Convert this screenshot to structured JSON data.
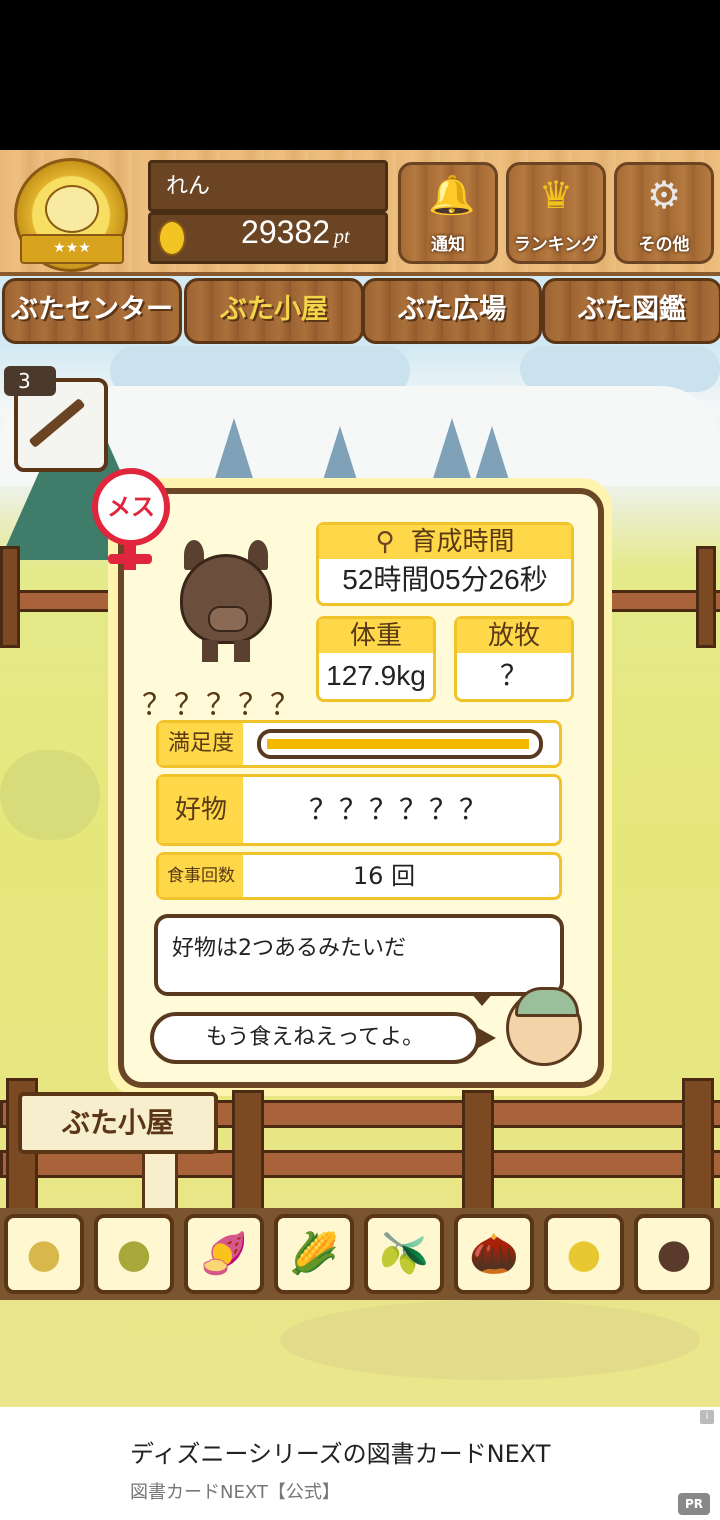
{
  "header": {
    "player_name": "れん",
    "points_value": "29382",
    "points_unit": "pt",
    "buttons": [
      {
        "label": "通知",
        "icon": "bell-icon"
      },
      {
        "label": "ランキング",
        "icon": "crown-icon"
      },
      {
        "label": "その他",
        "icon": "gear-icon"
      }
    ]
  },
  "tabs": [
    {
      "label": "ぶたセンター",
      "active": false
    },
    {
      "label": "ぶた小屋",
      "active": true
    },
    {
      "label": "ぶた広場",
      "active": false
    },
    {
      "label": "ぶた図鑑",
      "active": false
    }
  ],
  "item": {
    "count": "3",
    "icon": "syringe-icon"
  },
  "pig": {
    "gender_label": "メス",
    "name": "？？？？？",
    "growth_time_label": "育成時間",
    "growth_time_value": "52時間05分26秒",
    "weight_label": "体重",
    "weight_value": "127.9kg",
    "grazing_label": "放牧",
    "grazing_value": "？",
    "satisfaction_label": "満足度",
    "satisfaction_fraction": 1.0,
    "favorite_label": "好物",
    "favorite_value": "？？？？？？",
    "meals_label": "食事回数",
    "meals_value": "16 回",
    "hint_text": "好物は2つあるみたいだ",
    "farmer_text": "もう食えねえってよ。"
  },
  "sign": {
    "label": "ぶた小屋"
  },
  "foods": [
    {
      "icon": "soybean-icon",
      "glyph": "●"
    },
    {
      "icon": "mixed-bean-icon",
      "glyph": "●"
    },
    {
      "icon": "sweet-potato-icon",
      "glyph": "🍠"
    },
    {
      "icon": "corn-icon",
      "glyph": "🌽"
    },
    {
      "icon": "olive-icon",
      "glyph": "🫒"
    },
    {
      "icon": "acorn-icon",
      "glyph": "🌰"
    },
    {
      "icon": "chickpea-icon",
      "glyph": "●"
    },
    {
      "icon": "meatball-icon",
      "glyph": "●"
    }
  ],
  "ad": {
    "title": "ディズニーシリーズの図書カードNEXT",
    "advertiser": "図書カードNEXT【公式】",
    "pr_badge": "PR",
    "info_glyph": "i"
  },
  "colors": {
    "accent": "#ffd84a",
    "gender": "#e0253c",
    "wood_dark": "#5a3516",
    "satisfaction_fill": "#f5b800"
  }
}
